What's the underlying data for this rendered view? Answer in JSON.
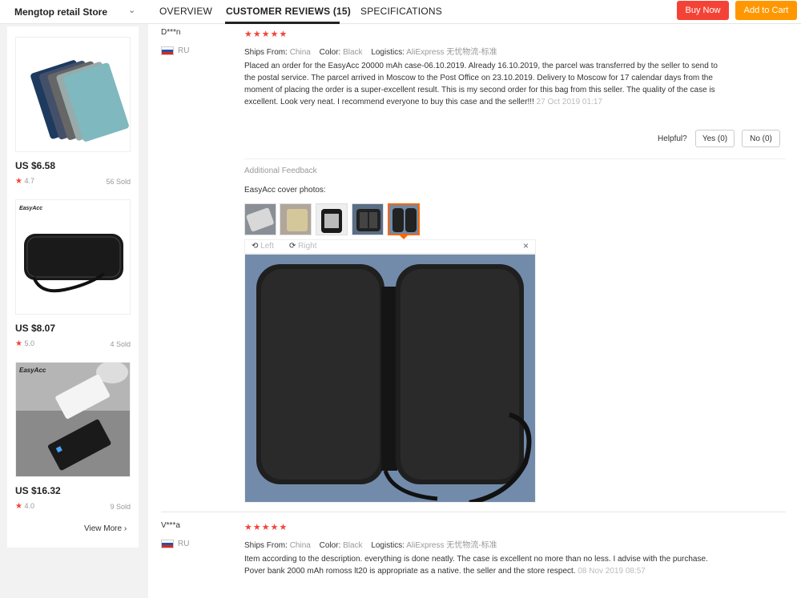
{
  "header": {
    "store_name": "Mengtop retail Store",
    "tabs": [
      "OVERVIEW",
      "CUSTOMER REVIEWS (15)",
      "SPECIFICATIONS"
    ],
    "buy_now": "Buy Now",
    "add_to_cart": "Add to Cart",
    "buy_color": "#f44336",
    "cart_color": "#ff9800"
  },
  "sidebar": {
    "products": [
      {
        "price": "US $6.58",
        "rating": "4.7",
        "sold": "56 Sold"
      },
      {
        "price": "US $8.07",
        "rating": "5.0",
        "sold": "4 Sold",
        "brand": "EasyAcc"
      },
      {
        "price": "US $16.32",
        "rating": "4.0",
        "sold": "9 Sold",
        "brand": "EasyAcc"
      }
    ],
    "view_more": "View More"
  },
  "reviews": [
    {
      "author": "D***n",
      "country": "RU",
      "stars": "★★★★★",
      "ships_from_label": "Ships From:",
      "ships_from": "China",
      "color_label": "Color:",
      "color": "Black",
      "logistics_label": "Logistics:",
      "logistics": "AliExpress 无忧物流-标准",
      "text": "Placed an order for the EasyAcc 20000 mAh case-06.10.2019. Already 16.10.2019, the parcel was transferred by the seller to send to the postal service. The parcel arrived in Moscow to the Post Office on 23.10.2019. Delivery to Moscow for 17 calendar days from the moment of placing the order is a super-excellent result. This is my second order for this bag from this seller. The quality of the case is excellent. Look very neat. I recommend everyone to buy this case and the seller!!!",
      "date": "27 Oct 2019 01:17",
      "helpful_label": "Helpful?",
      "yes_label": "Yes (0)",
      "no_label": "No (0)",
      "additional_label": "Additional Feedback",
      "additional_text": "EasyAcc cover photos:",
      "viewer": {
        "left": "Left",
        "right": "Right",
        "close": "×"
      }
    },
    {
      "author": "V***a",
      "country": "RU",
      "stars": "★★★★★",
      "ships_from_label": "Ships From:",
      "ships_from": "China",
      "color_label": "Color:",
      "color": "Black",
      "logistics_label": "Logistics:",
      "logistics": "AliExpress 无忧物流-标准",
      "text": "Item according to the description. everything is done neatly. The case is excellent no more than no less. I advise with the purchase. Pover bank 2000 mAh romoss lt20 is appropriate as a native. the seller and the store respect.",
      "date": "08 Nov 2019 08:57"
    }
  ]
}
